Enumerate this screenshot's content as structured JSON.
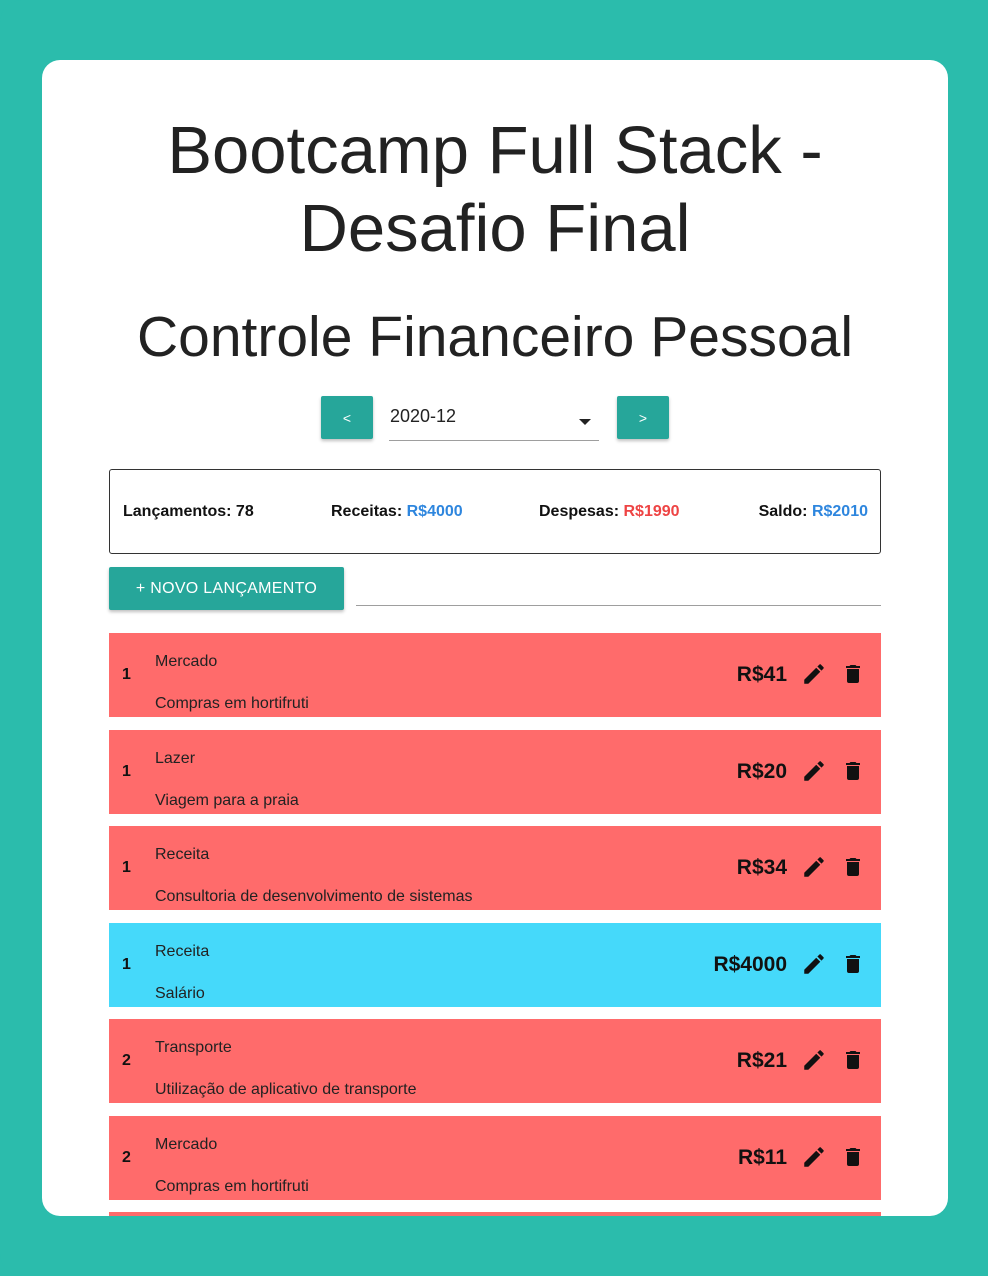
{
  "header": {
    "title_line1": "Bootcamp Full Stack -",
    "title_line2": "Desafio Final",
    "subtitle": "Controle Financeiro Pessoal"
  },
  "period": {
    "prev_label": "<",
    "next_label": ">",
    "selected": "2020-12"
  },
  "summary": {
    "count_label": "Lançamentos:",
    "count_value": "78",
    "revenue_label": "Receitas:",
    "revenue_value": "R$4000",
    "expense_label": "Despesas:",
    "expense_value": "R$1990",
    "balance_label": "Saldo:",
    "balance_value": "R$2010"
  },
  "actions": {
    "new_entry_label": "+ NOVO LANÇAMENTO",
    "filter_value": ""
  },
  "colors": {
    "accent": "#26a69a",
    "background": "#2bbcac",
    "expense_row": "#ff6b6b",
    "income_row": "#45d9fa",
    "positive_value": "#2e86de",
    "negative_value": "#ee4444"
  },
  "entries": [
    {
      "day": "1",
      "category": "Mercado",
      "description": "Compras em hortifruti",
      "value": "R$41",
      "type": "expense"
    },
    {
      "day": "1",
      "category": "Lazer",
      "description": "Viagem para a praia",
      "value": "R$20",
      "type": "expense"
    },
    {
      "day": "1",
      "category": "Receita",
      "description": "Consultoria de desenvolvimento de sistemas",
      "value": "R$34",
      "type": "expense"
    },
    {
      "day": "1",
      "category": "Receita",
      "description": "Salário",
      "value": "R$4000",
      "type": "income"
    },
    {
      "day": "2",
      "category": "Transporte",
      "description": "Utilização de aplicativo de transporte",
      "value": "R$21",
      "type": "expense"
    },
    {
      "day": "2",
      "category": "Mercado",
      "description": "Compras em hortifruti",
      "value": "R$11",
      "type": "expense"
    }
  ],
  "icons": {
    "edit": "pencil-icon",
    "delete": "trash-icon",
    "dropdown": "chevron-down-icon"
  }
}
